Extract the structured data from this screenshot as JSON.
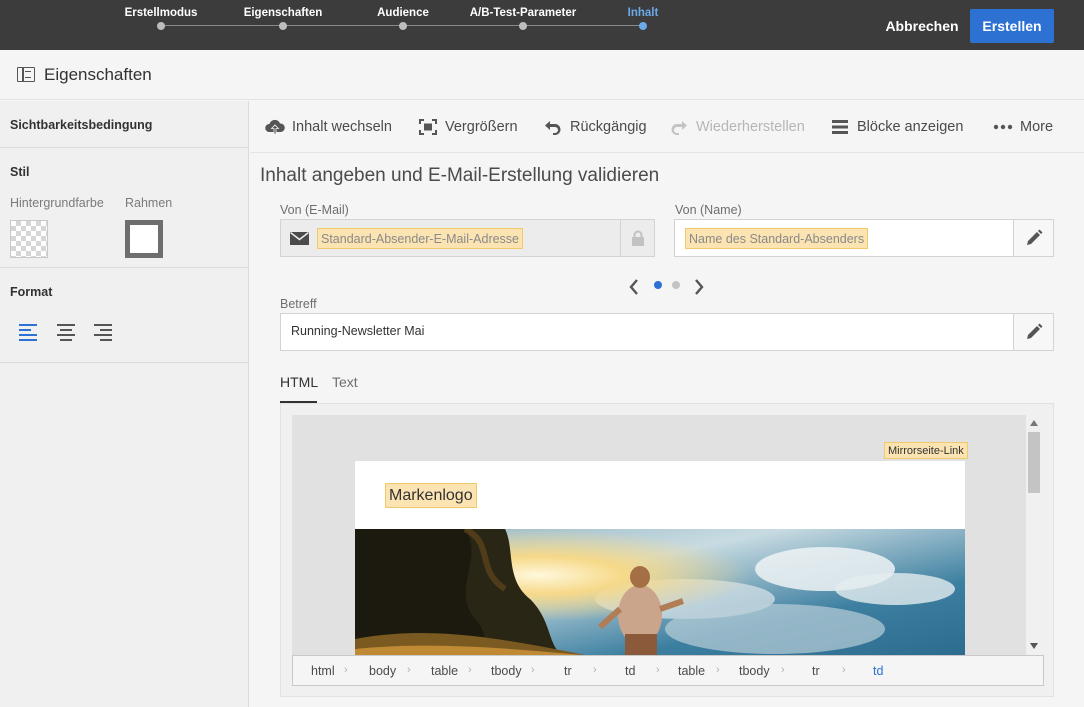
{
  "stepper": {
    "steps": [
      "Erstellmodus",
      "Eigenschaften",
      "Audience",
      "A/B-Test-Parameter",
      "Inhalt"
    ],
    "active_index": 4
  },
  "actions": {
    "cancel": "Abbrechen",
    "create": "Erstellen"
  },
  "properties_title": "Eigenschaften",
  "left_panel": {
    "visibility": "Sichtbarkeitsbedingung",
    "style": "Stil",
    "background_label": "Hintergrundfarbe",
    "border_label": "Rahmen",
    "format": "Format",
    "alignment_selected": "left"
  },
  "toolbar": {
    "change_content": "Inhalt wechseln",
    "enlarge": "Vergrößern",
    "undo": "Rückgängig",
    "redo": "Wiederherstellen",
    "show_blocks": "Blöcke anzeigen",
    "more": "More"
  },
  "content": {
    "heading": "Inhalt angeben und E-Mail-Erstellung validieren",
    "from_email_label": "Von (E-Mail)",
    "from_email_value": "Standard-Absender-E-Mail-Adresse",
    "from_name_label": "Von (Name)",
    "from_name_value": "Name des Standard-Absenders",
    "subject_label": "Betreff",
    "subject_value": "Running-Newsletter Mai",
    "pager": {
      "pages": 2,
      "current": 1
    }
  },
  "tabs": [
    "HTML",
    "Text"
  ],
  "active_tab": "HTML",
  "preview": {
    "mirror_link": "Mirrorseite-Link",
    "brand_logo": "Markenlogo"
  },
  "breadcrumb": [
    "html",
    "body",
    "table",
    "tbody",
    "tr",
    "td",
    "table",
    "tbody",
    "tr",
    "td"
  ],
  "colors": {
    "accent": "#2d72d2",
    "topbar": "#3c3c3c",
    "highlight": "#fbe3b2",
    "active_step": "#6aa9ea"
  }
}
